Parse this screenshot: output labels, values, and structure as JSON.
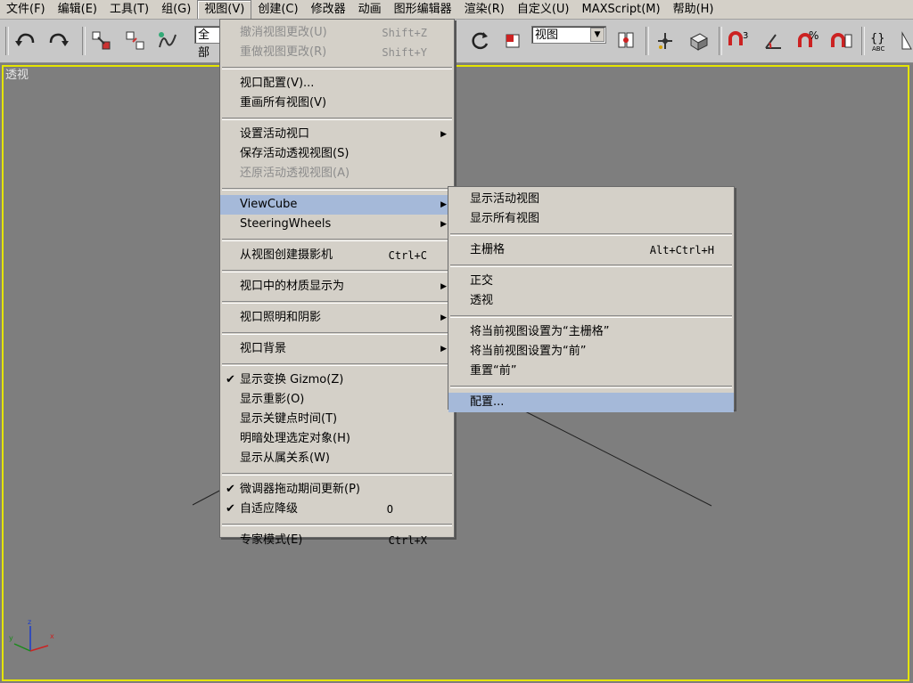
{
  "menubar": {
    "items": [
      "文件(F)",
      "编辑(E)",
      "工具(T)",
      "组(G)",
      "视图(V)",
      "创建(C)",
      "修改器",
      "动画",
      "图形编辑器",
      "渲染(R)",
      "自定义(U)",
      "MAXScript(M)",
      "帮助(H)"
    ]
  },
  "toolbar": {
    "selection_filter": "全部",
    "ref_coord": "视图"
  },
  "viewport": {
    "label": "透视"
  },
  "view_menu": {
    "undo": {
      "label": "撤消视图更改(U)",
      "shortcut": "Shift+Z"
    },
    "redo": {
      "label": "重做视图更改(R)",
      "shortcut": "Shift+Y"
    },
    "viewport_config": {
      "label": "视口配置(V)..."
    },
    "redraw_all": {
      "label": "重画所有视图(V)"
    },
    "set_active_viewport": {
      "label": "设置活动视口"
    },
    "save_active_persp": {
      "label": "保存活动透视视图(S)"
    },
    "restore_active_persp": {
      "label": "还原活动透视视图(A)"
    },
    "viewcube": {
      "label": "ViewCube"
    },
    "steeringwheels": {
      "label": "SteeringWheels"
    },
    "create_camera": {
      "label": "从视图创建摄影机",
      "shortcut": "Ctrl+C"
    },
    "material_display": {
      "label": "视口中的材质显示为"
    },
    "lighting_shadows": {
      "label": "视口照明和阴影"
    },
    "viewport_background": {
      "label": "视口背景"
    },
    "show_gizmo": {
      "label": "显示变换 Gizmo(Z)",
      "check": "✔"
    },
    "show_ghosting": {
      "label": "显示重影(O)"
    },
    "show_key_times": {
      "label": "显示关键点时间(T)"
    },
    "shade_selected": {
      "label": "明暗处理选定对象(H)"
    },
    "show_dependencies": {
      "label": "显示从属关系(W)"
    },
    "spinner_drag_update": {
      "label": "微调器拖动期间更新(P)",
      "check": "✔"
    },
    "adaptive_degradation": {
      "label": "自适应降级",
      "shortcut": "O",
      "check": "✔"
    },
    "expert_mode": {
      "label": "专家模式(E)",
      "shortcut": "Ctrl+X"
    }
  },
  "viewcube_menu": {
    "show_active": "显示活动视图",
    "show_all": "显示所有视图",
    "home": {
      "label": "主栅格",
      "shortcut": "Alt+Ctrl+H"
    },
    "ortho": "正交",
    "persp": "透视",
    "set_home": "将当前视图设置为“主栅格”",
    "set_front": "将当前视图设置为“前”",
    "reset_front": "重置“前”",
    "configure": "配置..."
  },
  "colors": {
    "menu_bg": "#d4d0c8",
    "highlight": "#a5b9d9",
    "viewport_bg": "#7e7e7e",
    "active_border": "#e4e400"
  }
}
